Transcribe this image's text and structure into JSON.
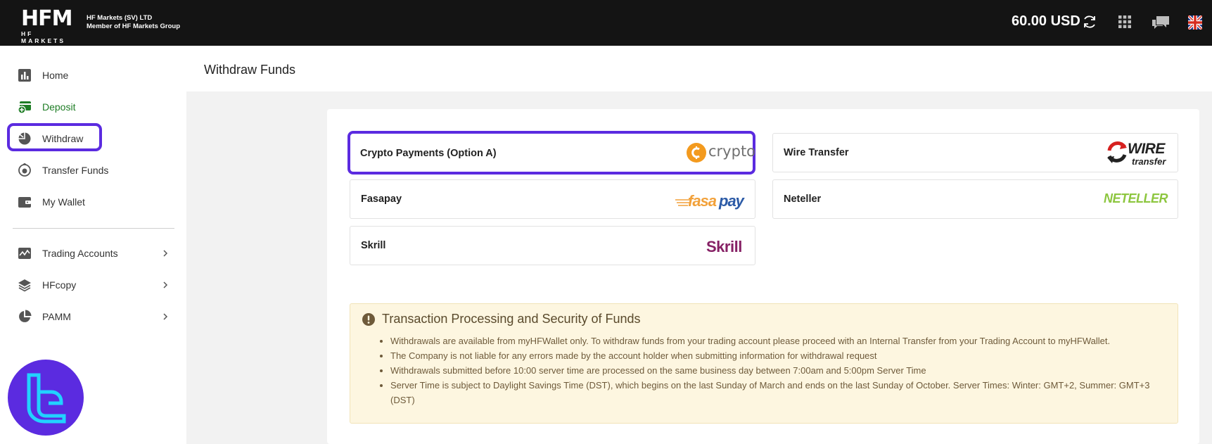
{
  "brand": {
    "logo_text": "HFM",
    "logo_subtext": "HF MARKETS",
    "company_line1": "HF Markets (SV) LTD",
    "company_line2": "Member of HF Markets Group"
  },
  "header": {
    "balance": "60.00 USD",
    "icons": [
      "refresh-icon",
      "apps-grid-icon",
      "chat-icon",
      "uk-flag-icon"
    ]
  },
  "sidebar": {
    "items": [
      {
        "label": "Home",
        "icon": "bar-chart-icon"
      },
      {
        "label": "Deposit",
        "icon": "deposit-icon"
      },
      {
        "label": "Withdraw",
        "icon": "withdraw-icon"
      },
      {
        "label": "Transfer Funds",
        "icon": "transfer-icon"
      },
      {
        "label": "My Wallet",
        "icon": "wallet-icon"
      },
      {
        "label": "Trading Accounts",
        "icon": "trading-chart-icon"
      },
      {
        "label": "HFcopy",
        "icon": "layers-icon"
      },
      {
        "label": "PAMM",
        "icon": "pie-chart-icon"
      }
    ]
  },
  "page": {
    "title": "Withdraw Funds"
  },
  "methods": [
    {
      "name": "Crypto Payments (Option A)",
      "logo_text": "crypto",
      "selected": true
    },
    {
      "name": "Wire Transfer",
      "logo_text_1": "WIRE",
      "logo_text_2": "transfer"
    },
    {
      "name": "Fasapay",
      "logo_text_1": "fasa",
      "logo_text_2": "pay"
    },
    {
      "name": "Neteller",
      "logo_text": "NETELLER"
    },
    {
      "name": "Skrill",
      "logo_text": "Skrill"
    }
  ],
  "notice": {
    "title": "Transaction Processing and Security of Funds",
    "items": [
      "Withdrawals are available from myHFWallet only. To withdraw funds from your trading account please proceed with an Internal Transfer from your Trading Account to myHFWallet.",
      "The Company is not liable for any errors made by the account holder when submitting information for withdrawal request",
      "Withdrawals submitted before 10:00 server time are processed on the same business day between 7:00am and 5:00pm Server Time",
      "Server Time is subject to Daylight Savings Time (DST), which begins on the last Sunday of March and ends on the last Sunday of October. Server Times: Winter: GMT+2, Summer: GMT+3 (DST)"
    ]
  },
  "colors": {
    "topbar": "#141414",
    "accent_red": "#e3202c",
    "highlight": "#5b2be0",
    "deposit_green": "#1e7d25",
    "notice_bg": "#fdf6e0"
  }
}
